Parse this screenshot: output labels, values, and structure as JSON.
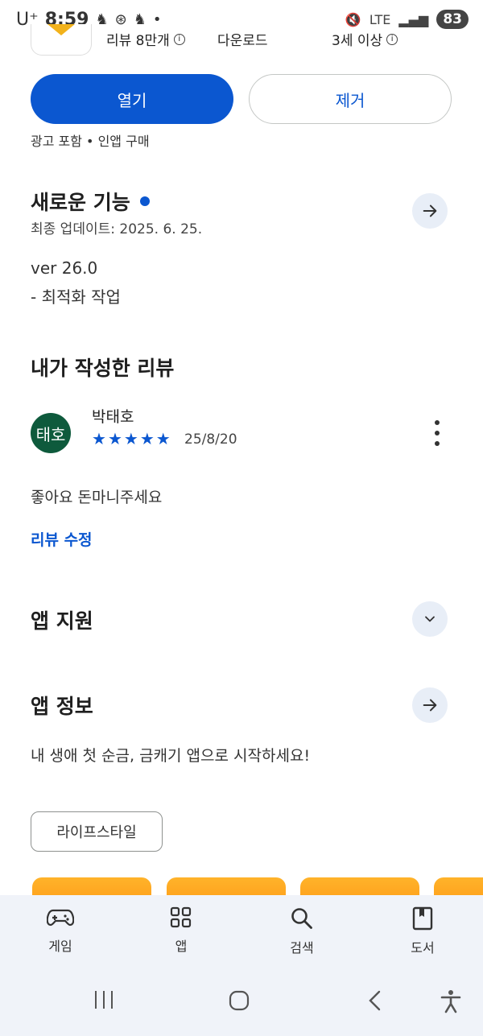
{
  "status_bar": {
    "carrier": "U⁺",
    "time": "8:59",
    "network": "LTE",
    "battery": "83"
  },
  "app_meta": {
    "reviews": "리뷰 8만개",
    "downloads": "다운로드",
    "age_rating": "3세 이상"
  },
  "actions": {
    "open_label": "열기",
    "remove_label": "제거",
    "ads_note": "광고 포함 • 인앱 구매"
  },
  "whats_new": {
    "title": "새로운 기능",
    "updated": "최종 업데이트: 2025. 6. 25.",
    "version": "ver 26.0",
    "notes": "- 최적화 작업"
  },
  "my_review": {
    "title": "내가 작성한 리뷰",
    "avatar_text": "태호",
    "reviewer_name": "박태호",
    "rating": 5,
    "date": "25/8/20",
    "text": "좋아요 돈마니주세요",
    "edit_label": "리뷰 수정"
  },
  "app_support": {
    "title": "앱 지원"
  },
  "app_info": {
    "title": "앱 정보",
    "description": "내 생애 첫 순금, 금캐기 앱으로 시작하세요!",
    "category_chip": "라이프스타일"
  },
  "bottom_nav": {
    "items": [
      {
        "label": "게임",
        "icon": "gamepad-icon"
      },
      {
        "label": "앱",
        "icon": "apps-grid-icon"
      },
      {
        "label": "검색",
        "icon": "search-icon"
      },
      {
        "label": "도서",
        "icon": "book-icon"
      }
    ]
  },
  "colors": {
    "accent": "#0b57d0",
    "avatar_bg": "#0e5a3c",
    "promo": "#ffa41f",
    "nav_bg": "#f0f3f9"
  }
}
